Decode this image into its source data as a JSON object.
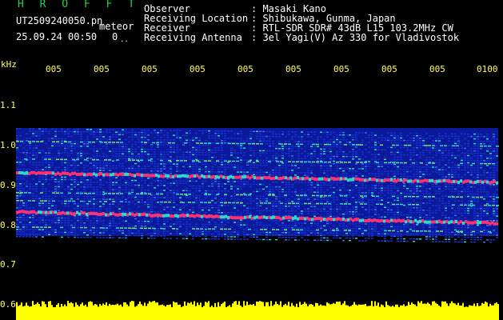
{
  "header": {
    "title": "H R O F F T",
    "filename": "UT2509240050.pn",
    "type": "meteor",
    "date": "25.09.24 00:50",
    "counter": "0",
    "dots": ".."
  },
  "info": {
    "labels": [
      "Observer",
      "Receiving Location",
      "Receiver",
      "Receiving Antenna"
    ],
    "values": [
      ": Masaki Kano",
      ": Shibukawa, Gunma, Japan",
      ": RTL-SDR SDR# 43dB L15 103.2MHz CW",
      ": 3el Yagi(V) Az 330 for Vladivostok"
    ]
  },
  "axis": {
    "unit": "kHz",
    "x_ticks": [
      "005",
      "005",
      "005",
      "005",
      "005",
      "005",
      "005",
      "005",
      "005",
      "0100"
    ],
    "y_ticks": [
      "1.1",
      "1.0",
      "0.9",
      "0.8",
      "0.7",
      "0.6"
    ]
  },
  "colors": {
    "background": "#000000",
    "text": "#ffffff",
    "title": "#27d44a",
    "axis": "#ffff66",
    "signal_low": "#1a2fd0",
    "signal_mid": "#2fd8c8",
    "signal_high": "#ff3070",
    "noise_floor": "#ffff00"
  }
}
